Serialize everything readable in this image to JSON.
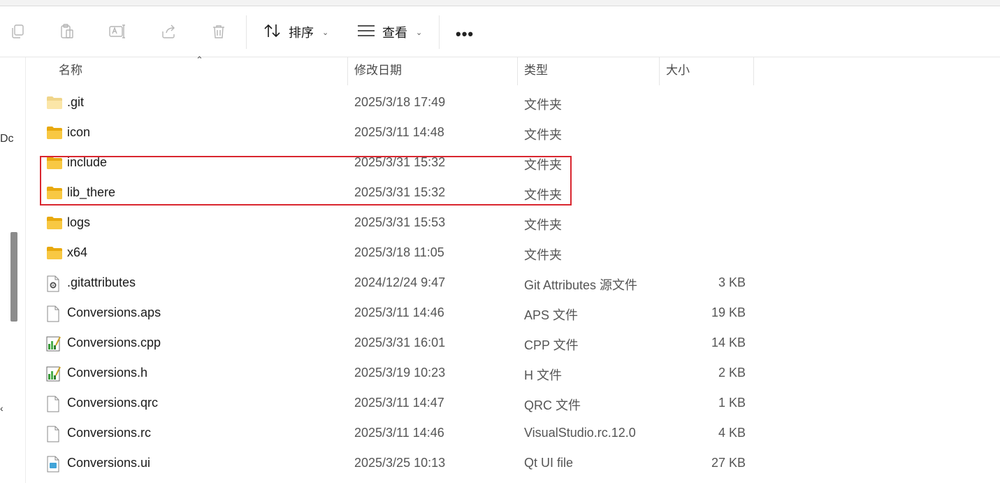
{
  "toolbar": {
    "copy_icon": "copy-icon",
    "paste_icon": "paste-icon",
    "rename_icon": "rename-icon",
    "share_icon": "share-icon",
    "delete_icon": "delete-icon",
    "sort_label": "排序",
    "view_label": "查看",
    "more_label": "•••"
  },
  "left_fragments": [
    "Dc",
    "‹"
  ],
  "columns": {
    "name": "名称",
    "date": "修改日期",
    "type": "类型",
    "size": "大小"
  },
  "files": [
    {
      "name": ".git",
      "date": "2025/3/18 17:49",
      "type": "文件夹",
      "size": "",
      "icon": "folder-light"
    },
    {
      "name": "icon",
      "date": "2025/3/11 14:48",
      "type": "文件夹",
      "size": "",
      "icon": "folder"
    },
    {
      "name": "include",
      "date": "2025/3/31 15:32",
      "type": "文件夹",
      "size": "",
      "icon": "folder"
    },
    {
      "name": "lib_there",
      "date": "2025/3/31 15:32",
      "type": "文件夹",
      "size": "",
      "icon": "folder"
    },
    {
      "name": "logs",
      "date": "2025/3/31 15:53",
      "type": "文件夹",
      "size": "",
      "icon": "folder"
    },
    {
      "name": "x64",
      "date": "2025/3/18 11:05",
      "type": "文件夹",
      "size": "",
      "icon": "folder"
    },
    {
      "name": ".gitattributes",
      "date": "2024/12/24 9:47",
      "type": "Git Attributes 源文件",
      "size": "3 KB",
      "icon": "settings-file"
    },
    {
      "name": "Conversions.aps",
      "date": "2025/3/11 14:46",
      "type": "APS 文件",
      "size": "19 KB",
      "icon": "blank-file"
    },
    {
      "name": "Conversions.cpp",
      "date": "2025/3/31 16:01",
      "type": "CPP 文件",
      "size": "14 KB",
      "icon": "code-file"
    },
    {
      "name": "Conversions.h",
      "date": "2025/3/19 10:23",
      "type": "H 文件",
      "size": "2 KB",
      "icon": "code-file"
    },
    {
      "name": "Conversions.qrc",
      "date": "2025/3/11 14:47",
      "type": "QRC 文件",
      "size": "1 KB",
      "icon": "blank-file"
    },
    {
      "name": "Conversions.rc",
      "date": "2025/3/11 14:46",
      "type": "VisualStudio.rc.12.0",
      "size": "4 KB",
      "icon": "blank-file"
    },
    {
      "name": "Conversions.ui",
      "date": "2025/3/25 10:13",
      "type": "Qt UI file",
      "size": "27 KB",
      "icon": "qt-ui-file"
    }
  ],
  "colors": {
    "highlight_border": "#d9262f",
    "folder": "#f5c542",
    "accent": "#1a73e8"
  }
}
